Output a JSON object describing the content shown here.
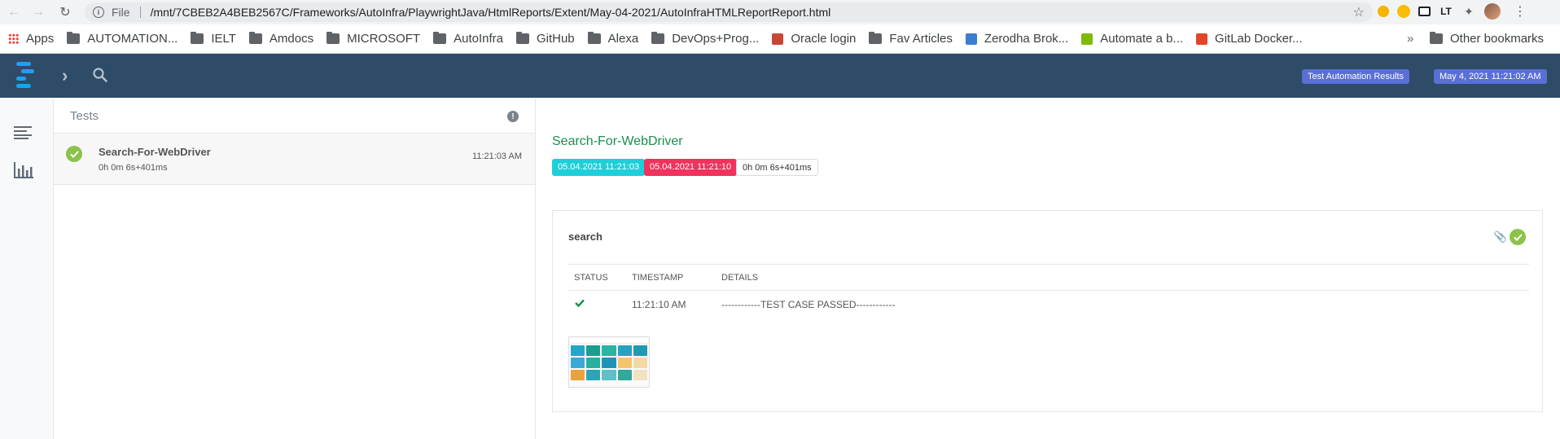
{
  "browser": {
    "address": {
      "file_label": "File",
      "url": "/mnt/7CBEB2A4BEB2567C/Frameworks/AutoInfra/PlaywrightJava/HtmlReports/Extent/May-04-2021/AutoInfraHTMLReportReport.html"
    },
    "bookmarks": [
      {
        "label": "Apps",
        "icon": "apps-grid-icon"
      },
      {
        "label": "AUTOMATION...",
        "icon": "folder-icon"
      },
      {
        "label": "IELT",
        "icon": "folder-icon"
      },
      {
        "label": "Amdocs",
        "icon": "folder-icon"
      },
      {
        "label": "MICROSOFT",
        "icon": "folder-icon"
      },
      {
        "label": "AutoInfra",
        "icon": "folder-icon"
      },
      {
        "label": "GitHub",
        "icon": "folder-icon"
      },
      {
        "label": "Alexa",
        "icon": "folder-icon"
      },
      {
        "label": "DevOps+Prog...",
        "icon": "folder-icon"
      },
      {
        "label": "Oracle login",
        "icon": "oracle-icon"
      },
      {
        "label": "Fav Articles",
        "icon": "folder-icon"
      },
      {
        "label": "Zerodha Brok...",
        "icon": "zerodha-icon"
      },
      {
        "label": "Automate a b...",
        "icon": "microsoft-icon"
      },
      {
        "label": "GitLab Docker...",
        "icon": "gitlab-icon"
      }
    ],
    "overflow_label": "»",
    "other_bookmarks": "Other bookmarks"
  },
  "header": {
    "report_name_badge": "Test Automation Results",
    "date_badge": "May 4, 2021 11:21:02 AM"
  },
  "test_list": {
    "heading": "Tests",
    "items": [
      {
        "name": "Search-For-WebDriver",
        "duration": "0h 0m 6s+401ms",
        "time": "11:21:03 AM",
        "status": "pass"
      }
    ]
  },
  "detail": {
    "title": "Search-For-WebDriver",
    "start_badge": "05.04.2021 11:21:03",
    "end_badge": "05.04.2021 11:21:10",
    "duration_badge": "0h 0m 6s+401ms",
    "node": {
      "name": "search",
      "columns": [
        "STATUS",
        "TIMESTAMP",
        "DETAILS"
      ],
      "rows": [
        {
          "status": "pass",
          "timestamp": "11:21:10 AM",
          "details": "------------TEST CASE PASSED------------"
        }
      ]
    }
  },
  "colors": {
    "header_bg": "#2e4b68",
    "pass": "#8bc34a",
    "start_badge": "#1ccfd9",
    "end_badge": "#f0325c",
    "title_green": "#1a8f4e"
  }
}
